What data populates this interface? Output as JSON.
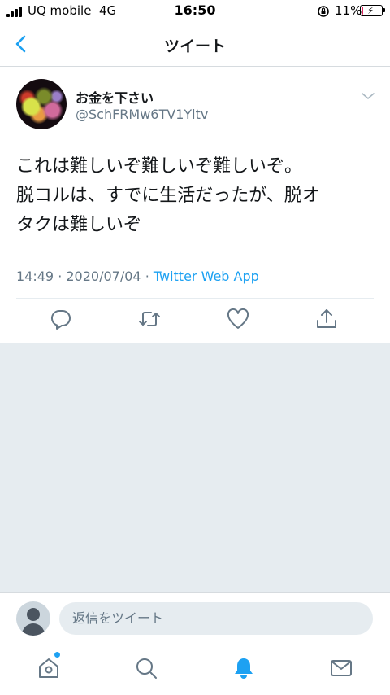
{
  "status_bar": {
    "carrier": "UQ mobile",
    "network": "4G",
    "time": "16:50",
    "battery_percent": "11%",
    "battery_level": 0.11,
    "battery_color": "#e0245e"
  },
  "header": {
    "title": "ツイート",
    "back_icon": "chevron-left-icon"
  },
  "tweet": {
    "user_name": "お金を下さい",
    "user_handle": "@SchFRMw6TV1Yltv",
    "text": "これは難しいぞ難しいぞ難しいぞ。\n脱コルは、すでに生活だったが、脱オ\nタクは難しいぞ",
    "time": "14:49",
    "date": "2020/07/04",
    "source": "Twitter Web App",
    "actions": [
      "reply-icon",
      "retweet-icon",
      "like-icon",
      "share-icon"
    ]
  },
  "reply_bar": {
    "placeholder": "返信をツイート"
  },
  "tabs": [
    "home-icon",
    "search-icon",
    "notifications-icon",
    "messages-icon"
  ],
  "colors": {
    "accent": "#1da1f2",
    "text": "#14171a",
    "secondary_text": "#657786",
    "background_gray": "#e6ecf0"
  }
}
